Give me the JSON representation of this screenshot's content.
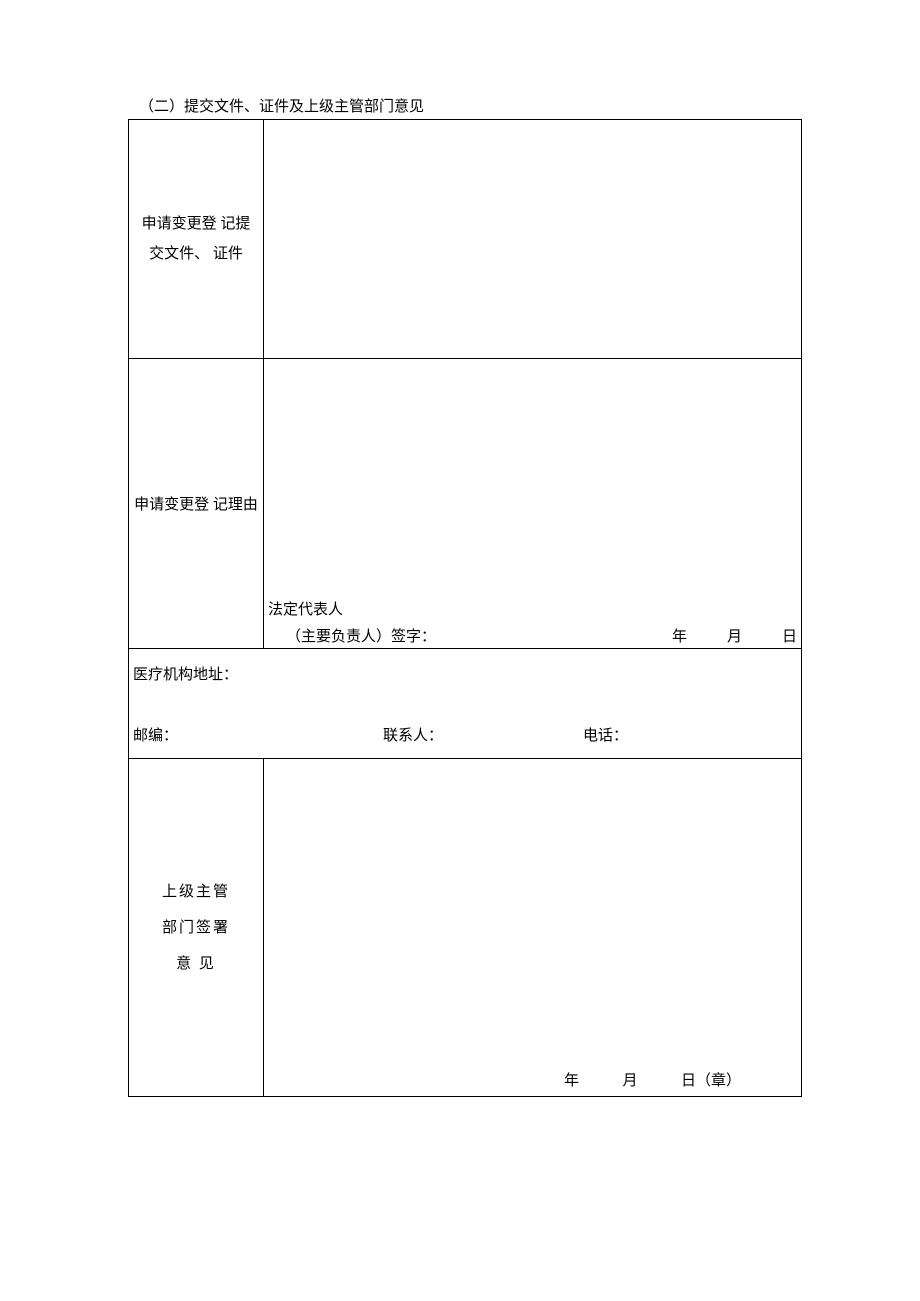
{
  "section_title": "（二）提交文件、证件及上级主管部门意见",
  "rows": {
    "documents": {
      "label": "申请变更登 记提交文件、 证件"
    },
    "reason": {
      "label": "申请变更登 记理由",
      "signature": {
        "line1": "法定代表人",
        "line2_label": "（主要负责人）签字：",
        "year": "年",
        "month": "月",
        "day": "日"
      }
    },
    "contact": {
      "address_label": "医疗机构地址：",
      "postcode_label": "邮编：",
      "contact_person_label": "联系人：",
      "phone_label": "电话："
    },
    "superior": {
      "label_line1": "上级主管",
      "label_line2": "部门签署",
      "label_line3": "意 见",
      "date": {
        "year": "年",
        "month": "月",
        "day_stamp": "日（章）"
      }
    }
  }
}
